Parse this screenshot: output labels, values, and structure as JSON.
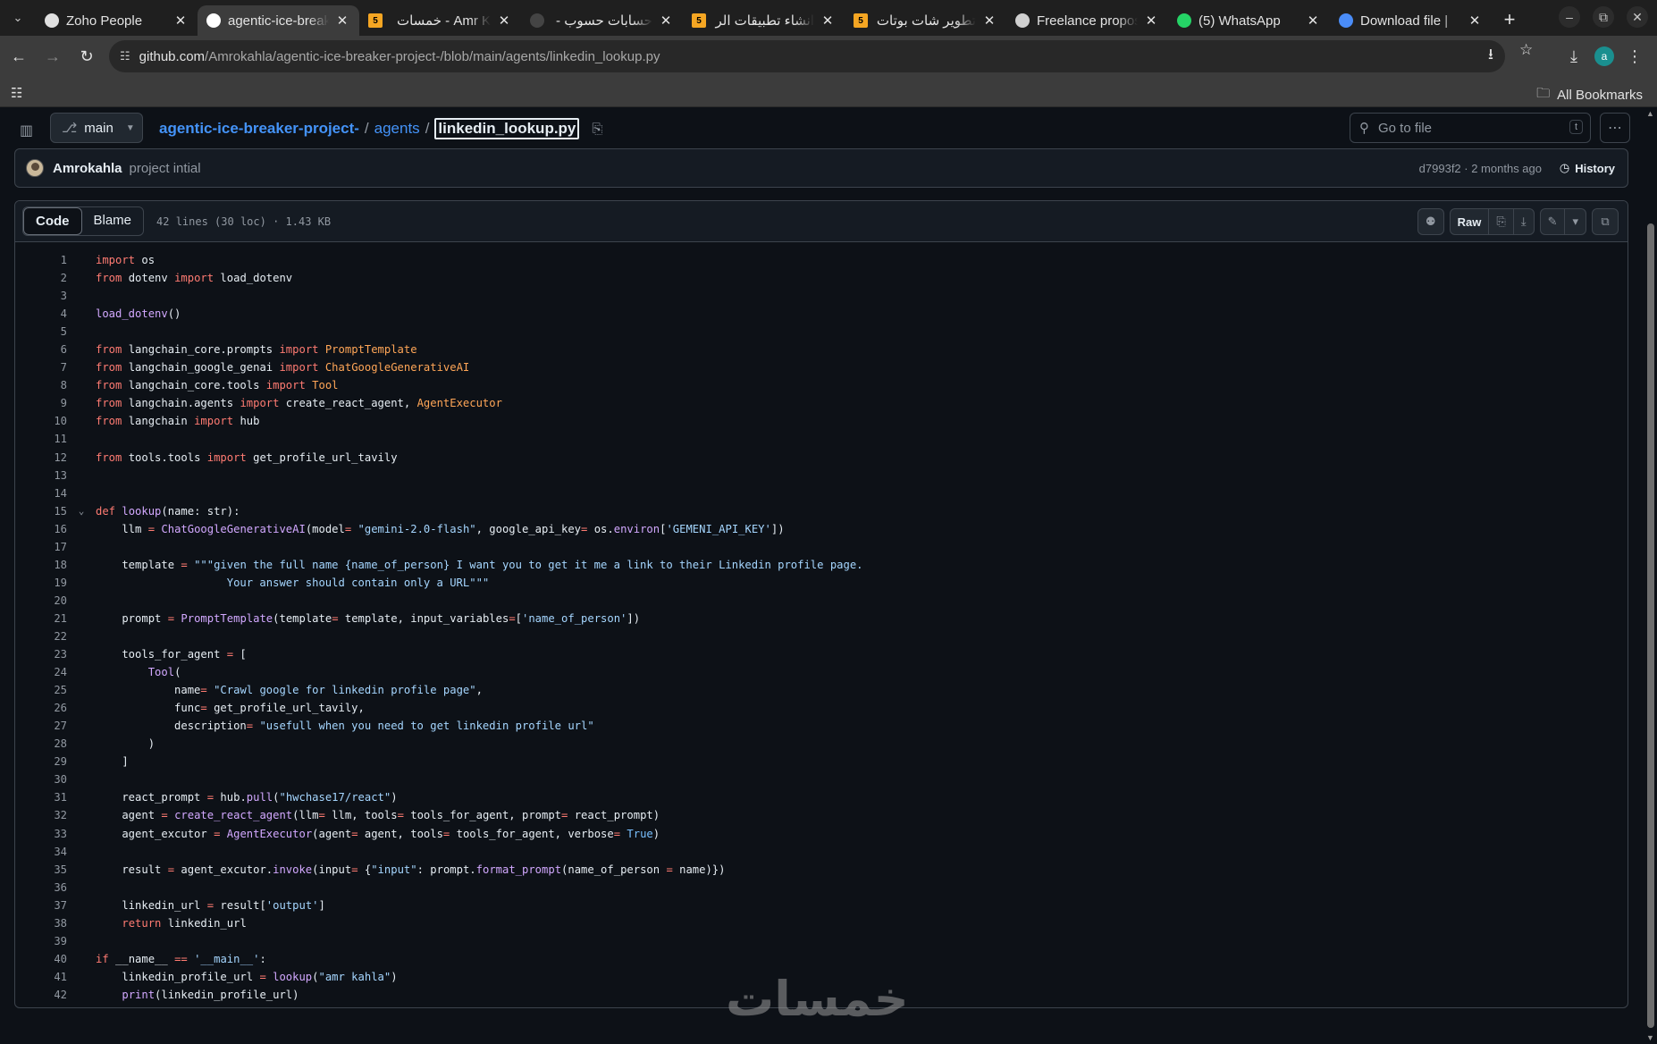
{
  "browser": {
    "tabs": [
      {
        "title": "Zoho People",
        "fav_color": "#e0e0e0",
        "fav_char": "",
        "active": false,
        "rtl": false
      },
      {
        "title": "agentic-ice-breaker-project",
        "fav_color": "#ffffff",
        "fav_char": "",
        "active": true,
        "rtl": false
      },
      {
        "title": "Amr K - خمسات",
        "fav_color": "#f5a623",
        "fav_char": "5",
        "active": false,
        "rtl": true
      },
      {
        "title": "حسابات حسوب -",
        "fav_color": "#444444",
        "fav_char": "",
        "active": false,
        "rtl": true
      },
      {
        "title": "انشاء تطبيقات الر",
        "fav_color": "#f5a623",
        "fav_char": "5",
        "active": false,
        "rtl": true
      },
      {
        "title": "تطوير شات بوتات",
        "fav_color": "#f5a623",
        "fav_char": "5",
        "active": false,
        "rtl": true
      },
      {
        "title": "Freelance proposal",
        "fav_color": "#d0d0d0",
        "fav_char": "",
        "active": false,
        "rtl": false
      },
      {
        "title": "(5) WhatsApp",
        "fav_color": "#25d366",
        "fav_char": "",
        "active": false,
        "rtl": false
      },
      {
        "title": "Download file | ",
        "fav_color": "#4a8cf7",
        "fav_char": "",
        "active": false,
        "rtl": false
      }
    ],
    "url_host": "github.com",
    "url_path": "/Amrokahla/agentic-ice-breaker-project-/blob/main/agents/linkedin_lookup.py",
    "profile_initial": "a",
    "all_bookmarks": "All Bookmarks"
  },
  "repo": {
    "branch": "main",
    "repo_name": "agentic-ice-breaker-project-",
    "dir": "agents",
    "file": "linkedin_lookup.py",
    "goto_placeholder": "Go to file",
    "goto_kbd": "t"
  },
  "commit": {
    "author": "Amrokahla",
    "message": "project intial",
    "meta": "d7993f2 · 2 months ago",
    "history": "History"
  },
  "file": {
    "tab_code": "Code",
    "tab_blame": "Blame",
    "info": "42 lines (30 loc) · 1.43 KB",
    "raw": "Raw"
  },
  "code_lines": [
    [
      [
        "kw",
        "import"
      ],
      [
        "t",
        " os"
      ]
    ],
    [
      [
        "kw",
        "from"
      ],
      [
        "t",
        " dotenv "
      ],
      [
        "kw",
        "import"
      ],
      [
        "t",
        " load_dotenv"
      ]
    ],
    [],
    [
      [
        "fn",
        "load_dotenv"
      ],
      [
        "t",
        "()"
      ]
    ],
    [],
    [
      [
        "kw",
        "from"
      ],
      [
        "t",
        " langchain_core.prompts "
      ],
      [
        "kw",
        "import"
      ],
      [
        "t",
        " "
      ],
      [
        "cls",
        "PromptTemplate"
      ]
    ],
    [
      [
        "kw",
        "from"
      ],
      [
        "t",
        " langchain_google_genai "
      ],
      [
        "kw",
        "import"
      ],
      [
        "t",
        " "
      ],
      [
        "cls",
        "ChatGoogleGenerativeAI"
      ]
    ],
    [
      [
        "kw",
        "from"
      ],
      [
        "t",
        " langchain_core.tools "
      ],
      [
        "kw",
        "import"
      ],
      [
        "t",
        " "
      ],
      [
        "cls",
        "Tool"
      ]
    ],
    [
      [
        "kw",
        "from"
      ],
      [
        "t",
        " langchain.agents "
      ],
      [
        "kw",
        "import"
      ],
      [
        "t",
        " create_react_agent, "
      ],
      [
        "cls",
        "AgentExecutor"
      ]
    ],
    [
      [
        "kw",
        "from"
      ],
      [
        "t",
        " langchain "
      ],
      [
        "kw",
        "import"
      ],
      [
        "t",
        " hub"
      ]
    ],
    [],
    [
      [
        "kw",
        "from"
      ],
      [
        "t",
        " tools.tools "
      ],
      [
        "kw",
        "import"
      ],
      [
        "t",
        " get_profile_url_tavily"
      ]
    ],
    [],
    [],
    [
      [
        "kw",
        "def"
      ],
      [
        "t",
        " "
      ],
      [
        "fn",
        "lookup"
      ],
      [
        "t",
        "(name: str):"
      ]
    ],
    [
      [
        "t",
        "    llm "
      ],
      [
        "kw",
        "="
      ],
      [
        "t",
        " "
      ],
      [
        "fn",
        "ChatGoogleGenerativeAI"
      ],
      [
        "t",
        "(model"
      ],
      [
        "kw",
        "="
      ],
      [
        "t",
        " "
      ],
      [
        "str",
        "\"gemini-2.0-flash\""
      ],
      [
        "t",
        ", google_api_key"
      ],
      [
        "kw",
        "="
      ],
      [
        "t",
        " os."
      ],
      [
        "fn",
        "environ"
      ],
      [
        "t",
        "["
      ],
      [
        "str",
        "'GEMENI_API_KEY'"
      ],
      [
        "t",
        "])"
      ]
    ],
    [],
    [
      [
        "t",
        "    template "
      ],
      [
        "kw",
        "="
      ],
      [
        "t",
        " "
      ],
      [
        "str",
        "\"\"\"given the full name {name_of_person} I want you to get it me a link to their Linkedin profile page."
      ]
    ],
    [
      [
        "str",
        "                    Your answer should contain only a URL\"\"\""
      ]
    ],
    [],
    [
      [
        "t",
        "    prompt "
      ],
      [
        "kw",
        "="
      ],
      [
        "t",
        " "
      ],
      [
        "fn",
        "PromptTemplate"
      ],
      [
        "t",
        "(template"
      ],
      [
        "kw",
        "="
      ],
      [
        "t",
        " template, input_variables"
      ],
      [
        "kw",
        "="
      ],
      [
        "t",
        "["
      ],
      [
        "str",
        "'name_of_person'"
      ],
      [
        "t",
        "])"
      ]
    ],
    [],
    [
      [
        "t",
        "    tools_for_agent "
      ],
      [
        "kw",
        "="
      ],
      [
        "t",
        " ["
      ]
    ],
    [
      [
        "t",
        "        "
      ],
      [
        "fn",
        "Tool"
      ],
      [
        "t",
        "("
      ]
    ],
    [
      [
        "t",
        "            name"
      ],
      [
        "kw",
        "="
      ],
      [
        "t",
        " "
      ],
      [
        "str",
        "\"Crawl google for linkedin profile page\""
      ],
      [
        "t",
        ","
      ]
    ],
    [
      [
        "t",
        "            func"
      ],
      [
        "kw",
        "="
      ],
      [
        "t",
        " get_profile_url_tavily,"
      ]
    ],
    [
      [
        "t",
        "            description"
      ],
      [
        "kw",
        "="
      ],
      [
        "t",
        " "
      ],
      [
        "str",
        "\"usefull when you need to get linkedin profile url\""
      ]
    ],
    [
      [
        "t",
        "        )"
      ]
    ],
    [
      [
        "t",
        "    ]"
      ]
    ],
    [],
    [
      [
        "t",
        "    react_prompt "
      ],
      [
        "kw",
        "="
      ],
      [
        "t",
        " hub."
      ],
      [
        "fn",
        "pull"
      ],
      [
        "t",
        "("
      ],
      [
        "str",
        "\"hwchase17/react\""
      ],
      [
        "t",
        ")"
      ]
    ],
    [
      [
        "t",
        "    agent "
      ],
      [
        "kw",
        "="
      ],
      [
        "t",
        " "
      ],
      [
        "fn",
        "create_react_agent"
      ],
      [
        "t",
        "(llm"
      ],
      [
        "kw",
        "="
      ],
      [
        "t",
        " llm, tools"
      ],
      [
        "kw",
        "="
      ],
      [
        "t",
        " tools_for_agent, prompt"
      ],
      [
        "kw",
        "="
      ],
      [
        "t",
        " react_prompt)"
      ]
    ],
    [
      [
        "t",
        "    agent_excutor "
      ],
      [
        "kw",
        "="
      ],
      [
        "t",
        " "
      ],
      [
        "fn",
        "AgentExecutor"
      ],
      [
        "t",
        "(agent"
      ],
      [
        "kw",
        "="
      ],
      [
        "t",
        " agent, tools"
      ],
      [
        "kw",
        "="
      ],
      [
        "t",
        " tools_for_agent, verbose"
      ],
      [
        "kw",
        "="
      ],
      [
        "t",
        " "
      ],
      [
        "const",
        "True"
      ],
      [
        "t",
        ")"
      ]
    ],
    [],
    [
      [
        "t",
        "    result "
      ],
      [
        "kw",
        "="
      ],
      [
        "t",
        " agent_excutor."
      ],
      [
        "fn",
        "invoke"
      ],
      [
        "t",
        "(input"
      ],
      [
        "kw",
        "="
      ],
      [
        "t",
        " {"
      ],
      [
        "str",
        "\"input\""
      ],
      [
        "t",
        ": prompt."
      ],
      [
        "fn",
        "format_prompt"
      ],
      [
        "t",
        "(name_of_person "
      ],
      [
        "kw",
        "="
      ],
      [
        "t",
        " name)})"
      ]
    ],
    [],
    [
      [
        "t",
        "    linkedin_url "
      ],
      [
        "kw",
        "="
      ],
      [
        "t",
        " result["
      ],
      [
        "str",
        "'output'"
      ],
      [
        "t",
        "]"
      ]
    ],
    [
      [
        "t",
        "    "
      ],
      [
        "kw",
        "return"
      ],
      [
        "t",
        " linkedin_url"
      ]
    ],
    [],
    [
      [
        "kw",
        "if"
      ],
      [
        "t",
        " __name__ "
      ],
      [
        "kw",
        "=="
      ],
      [
        "t",
        " "
      ],
      [
        "str",
        "'__main__'"
      ],
      [
        "t",
        ":"
      ]
    ],
    [
      [
        "t",
        "    linkedin_profile_url "
      ],
      [
        "kw",
        "="
      ],
      [
        "t",
        " "
      ],
      [
        "fn",
        "lookup"
      ],
      [
        "t",
        "("
      ],
      [
        "str",
        "\"amr kahla\""
      ],
      [
        "t",
        ")"
      ]
    ],
    [
      [
        "t",
        "    "
      ],
      [
        "fn",
        "print"
      ],
      [
        "t",
        "(linkedin_profile_url)"
      ]
    ]
  ],
  "watermark": "خمسات"
}
